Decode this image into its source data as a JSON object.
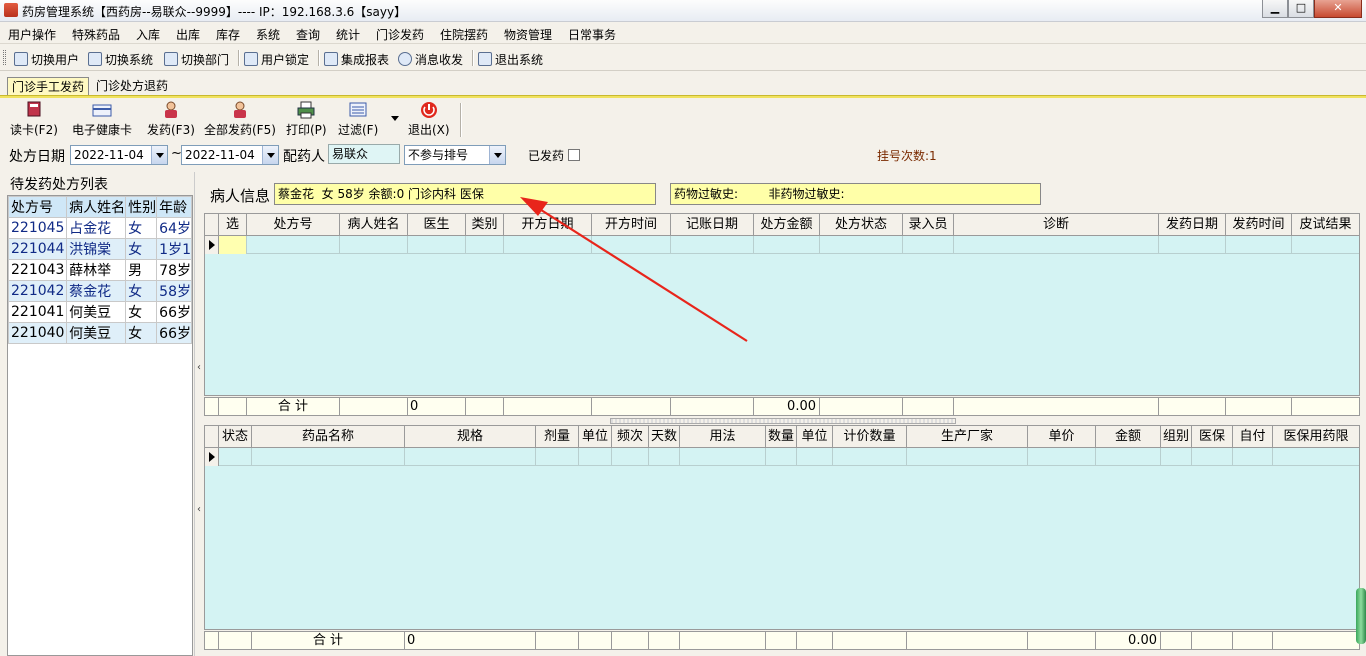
{
  "window": {
    "title": "药房管理系统【西药房--易联众--9999】---- IP：192.168.3.6【sayy】",
    "controls": [
      "▁",
      "□",
      "✕"
    ]
  },
  "menu": [
    "用户操作",
    "特殊药品",
    "入库",
    "出库",
    "库存",
    "系统",
    "查询",
    "统计",
    "门诊发药",
    "住院摆药",
    "物资管理",
    "日常事务"
  ],
  "toolbar": [
    "切换用户",
    "切换系统",
    "切换部门",
    "用户锁定",
    "集成报表",
    "消息收发",
    "退出系统"
  ],
  "tabs": [
    "门诊手工发药",
    "门诊处方退药"
  ],
  "actions": [
    "读卡(F2)",
    "电子健康卡",
    "发药(F3)",
    "全部发药(F5)",
    "打印(P)",
    "过滤(F)",
    "退出(X)"
  ],
  "filter": {
    "date_label": "处方日期",
    "date_from": "2022-11-04",
    "tilde": "~",
    "date_to": "2022-11-04",
    "dispenser_label": "配药人",
    "dispenser": "易联众",
    "queue_option": "不参与排号",
    "dispensed_label": "已发药",
    "register_count": "挂号次数:1"
  },
  "pending_list": {
    "title": "待发药处方列表",
    "columns": [
      "处方号",
      "病人姓名",
      "性别",
      "年龄"
    ],
    "rows": [
      [
        "221045",
        "占金花",
        "女",
        "64岁"
      ],
      [
        "221044",
        "洪锦棠",
        "女",
        "1岁1"
      ],
      [
        "221043",
        "薛林举",
        "男",
        "78岁"
      ],
      [
        "221042",
        "蔡金花",
        "女",
        "58岁"
      ],
      [
        "221041",
        "何美豆",
        "女",
        "66岁"
      ],
      [
        "221040",
        "何美豆",
        "女",
        "66岁"
      ]
    ]
  },
  "patient": {
    "label": "病人信息",
    "info": "蔡金花  女 58岁 余额:0 门诊内科 医保",
    "allergy": "药物过敏史:        非药物过敏史:"
  },
  "prescription_grid": {
    "columns": [
      "选",
      "处方号",
      "病人姓名",
      "医生",
      "类别",
      "开方日期",
      "开方时间",
      "记账日期",
      "处方金额",
      "处方状态",
      "录入员",
      "诊断",
      "发药日期",
      "发药时间",
      "皮试结果"
    ],
    "total_label": "合   计",
    "total_count": "0",
    "total_amount": "0.00"
  },
  "drug_grid": {
    "columns": [
      "状态",
      "药品名称",
      "规格",
      "剂量",
      "单位",
      "频次",
      "天数",
      "用法",
      "数量",
      "单位",
      "计价数量",
      "生产厂家",
      "单价",
      "金额",
      "组别",
      "医保",
      "自付",
      "医保用药限"
    ],
    "total_label": "合   计",
    "total_count": "0",
    "total_amount": "0.00"
  },
  "colors": {
    "grid_bg": "#d4f3f3",
    "info_bg": "#ffffa8",
    "annotation_arrow": "#e8251b"
  }
}
